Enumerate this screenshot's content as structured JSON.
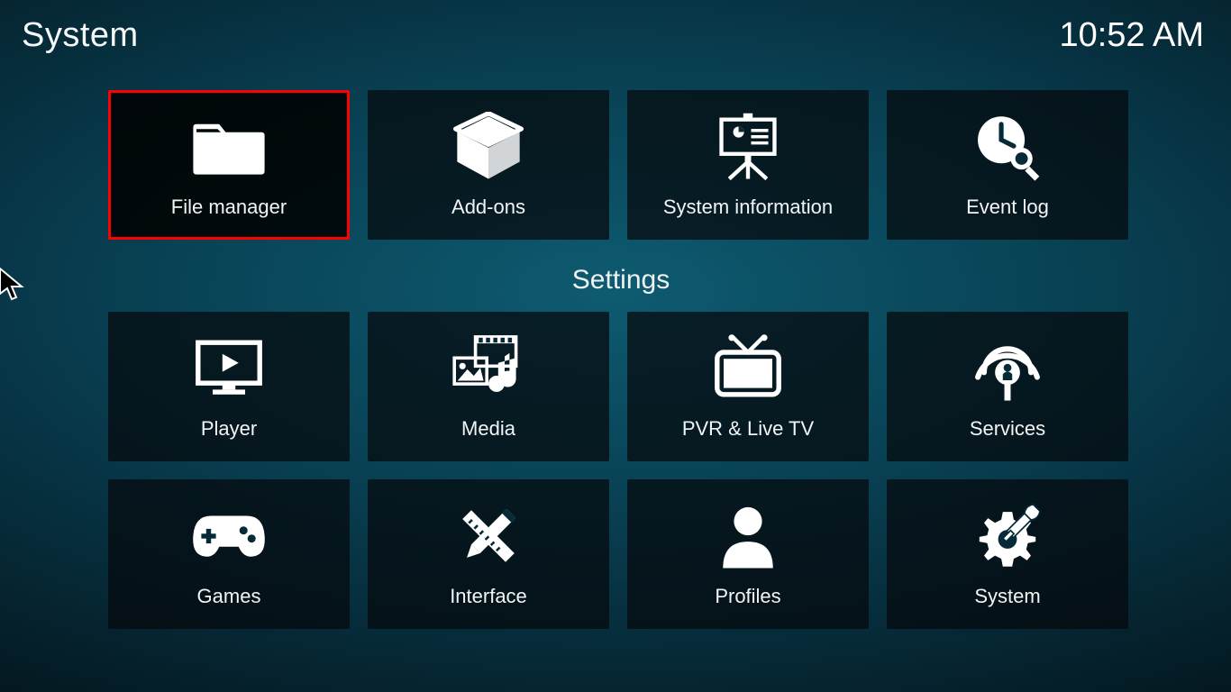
{
  "header": {
    "title": "System",
    "clock": "10:52 AM"
  },
  "top_row": [
    {
      "name": "file-manager",
      "label": "File manager",
      "highlight": true
    },
    {
      "name": "add-ons",
      "label": "Add-ons"
    },
    {
      "name": "system-information",
      "label": "System information"
    },
    {
      "name": "event-log",
      "label": "Event log"
    }
  ],
  "section_title": "Settings",
  "rows": [
    [
      {
        "name": "player",
        "label": "Player"
      },
      {
        "name": "media",
        "label": "Media"
      },
      {
        "name": "pvr-live-tv",
        "label": "PVR & Live TV"
      },
      {
        "name": "services",
        "label": "Services"
      }
    ],
    [
      {
        "name": "games",
        "label": "Games"
      },
      {
        "name": "interface",
        "label": "Interface"
      },
      {
        "name": "profiles",
        "label": "Profiles"
      },
      {
        "name": "system",
        "label": "System"
      }
    ]
  ]
}
